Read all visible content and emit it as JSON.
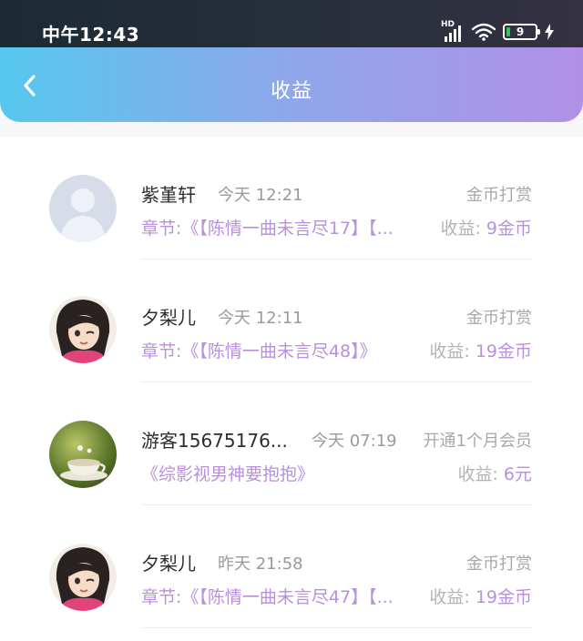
{
  "status_bar": {
    "time": "中午12:43",
    "signal_label": "HD",
    "battery": "9"
  },
  "header": {
    "title": "收益"
  },
  "records": [
    {
      "name": "紫堇轩",
      "time": "今天 12:21",
      "type": "金币打赏",
      "chapter": "章节:《【陈情一曲未言尽17】【...",
      "income_label": "收益: ",
      "income_value": "9金币",
      "avatar": "default-avatar"
    },
    {
      "name": "夕梨儿",
      "time": "今天 12:11",
      "type": "金币打赏",
      "chapter": "章节:《【陈情一曲未言尽48】》",
      "income_label": "收益: ",
      "income_value": "19金币",
      "avatar": "anime-girl-avatar"
    },
    {
      "name": "游客15675176...",
      "time": "今天 07:19",
      "type": "开通1个月会员",
      "chapter": "《综影视男神要抱抱》",
      "income_label": "收益: ",
      "income_value": "6元",
      "avatar": "teacup-avatar"
    },
    {
      "name": "夕梨儿",
      "time": "昨天 21:58",
      "type": "金币打赏",
      "chapter": "章节:《【陈情一曲未言尽47】【...",
      "income_label": "收益: ",
      "income_value": "19金币",
      "avatar": "anime-girl-avatar"
    }
  ],
  "colors": {
    "accent_purple": "#b890db",
    "header_gradient_start": "#56c8ef",
    "header_gradient_end": "#b190e7"
  }
}
